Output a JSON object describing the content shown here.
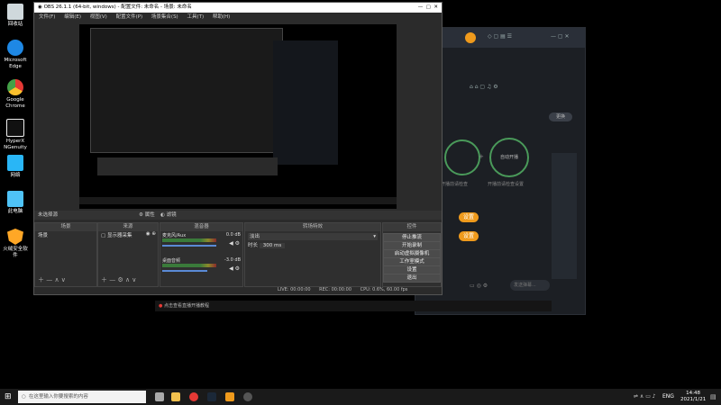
{
  "desktop": {
    "icons": [
      {
        "label": "回收站",
        "color": "#cfd8dc"
      },
      {
        "label": "Microsoft Edge",
        "color": "#1e88e5"
      },
      {
        "label": "Google Chrome",
        "color": "#e53935"
      },
      {
        "label": "HyperX NGenuity",
        "color": "#eeeeee"
      },
      {
        "label": "网络",
        "color": "#29b6f6"
      },
      {
        "label": "此电脑",
        "color": "#4fc3f7"
      },
      {
        "label": "火绒安全软件",
        "color": "#ffa726"
      }
    ]
  },
  "obs": {
    "title": "OBS 26.1.1 (64-bit, windows) - 配置文件: 未命名 - 场景: 未命名",
    "menu": [
      "文件(F)",
      "编辑(E)",
      "视图(V)",
      "配置文件(P)",
      "场景集合(S)",
      "工具(T)",
      "帮助(H)"
    ],
    "status_label": "未选择源",
    "props_btn": "属性",
    "filters_btn": "滤镜",
    "scenes": {
      "header": "场景",
      "items": [
        "场景"
      ]
    },
    "sources": {
      "header": "来源",
      "items": [
        "显示器采集"
      ]
    },
    "mixer": {
      "header": "混音器",
      "tracks": [
        {
          "name": "麦克风/Aux",
          "db": "0.0 dB"
        },
        {
          "name": "桌面音频",
          "db": "-3.0 dB"
        }
      ]
    },
    "transitions": {
      "header": "转场特效",
      "type": "淡出",
      "duration_label": "时长",
      "duration_value": "300 ms"
    },
    "controls": {
      "header": "控件",
      "buttons": [
        "停止推流",
        "开始录制",
        "启动虚拟摄像机",
        "工作室模式",
        "设置",
        "退出"
      ]
    },
    "statusbar": {
      "live": "LIVE: 00:00:00",
      "rec": "REC: 00:00:00",
      "cpu": "CPU: 0.6%, 60.00 fps"
    }
  },
  "right_app": {
    "button_top": "更换",
    "left_circle": "",
    "right_circle": "自动开播",
    "caption_left": "开播前请检查",
    "caption_right": "开播前请检查设置",
    "orange1": "设置",
    "orange2": "设置",
    "input_placeholder": "发送弹幕..."
  },
  "bottom_bar": {
    "tip": "点击查看直播开播教程"
  },
  "taskbar": {
    "search_placeholder": "在这里输入你要搜索的内容",
    "lang": "ENG",
    "time": "14:48",
    "date": "2021/1/21"
  },
  "colors": {
    "accent": "#ef9a1c",
    "obs_bg": "#2b2b2b",
    "green": "#4a9a5a"
  }
}
